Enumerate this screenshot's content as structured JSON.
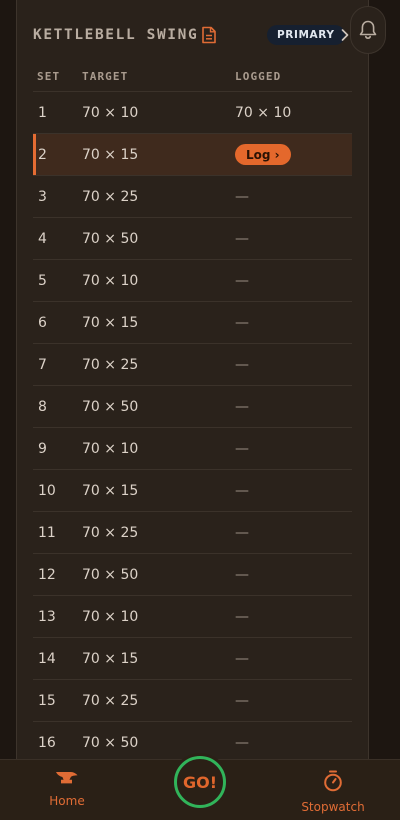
{
  "exercise": {
    "title": "KETTLEBELL SWING",
    "badge": "PRIMARY"
  },
  "table": {
    "headers": {
      "set": "SET",
      "target": "TARGET",
      "logged": "LOGGED"
    },
    "active_set": 2,
    "log_button_label": "Log ›",
    "rows": [
      {
        "set": "1",
        "target": "70 × 10",
        "logged": "70 × 10"
      },
      {
        "set": "2",
        "target": "70 × 15",
        "logged": ""
      },
      {
        "set": "3",
        "target": "70 × 25",
        "logged": "—"
      },
      {
        "set": "4",
        "target": "70 × 50",
        "logged": "—"
      },
      {
        "set": "5",
        "target": "70 × 10",
        "logged": "—"
      },
      {
        "set": "6",
        "target": "70 × 15",
        "logged": "—"
      },
      {
        "set": "7",
        "target": "70 × 25",
        "logged": "—"
      },
      {
        "set": "8",
        "target": "70 × 50",
        "logged": "—"
      },
      {
        "set": "9",
        "target": "70 × 10",
        "logged": "—"
      },
      {
        "set": "10",
        "target": "70 × 15",
        "logged": "—"
      },
      {
        "set": "11",
        "target": "70 × 25",
        "logged": "—"
      },
      {
        "set": "12",
        "target": "70 × 50",
        "logged": "—"
      },
      {
        "set": "13",
        "target": "70 × 10",
        "logged": "—"
      },
      {
        "set": "14",
        "target": "70 × 15",
        "logged": "—"
      },
      {
        "set": "15",
        "target": "70 × 25",
        "logged": "—"
      },
      {
        "set": "16",
        "target": "70 × 50",
        "logged": "—"
      }
    ]
  },
  "nav": {
    "home_label": "Home",
    "go_label": "GO!",
    "stopwatch_label": "Stopwatch"
  },
  "icons": {
    "notes": "notes-icon",
    "chevron": "chevron-right-icon",
    "bell": "bell-icon",
    "home": "anvil-icon",
    "stopwatch": "stopwatch-icon"
  },
  "colors": {
    "accent": "#e46c33",
    "go_ring": "#31b45a",
    "badge_bg": "#162030",
    "active_row": "#3f2a1d"
  }
}
